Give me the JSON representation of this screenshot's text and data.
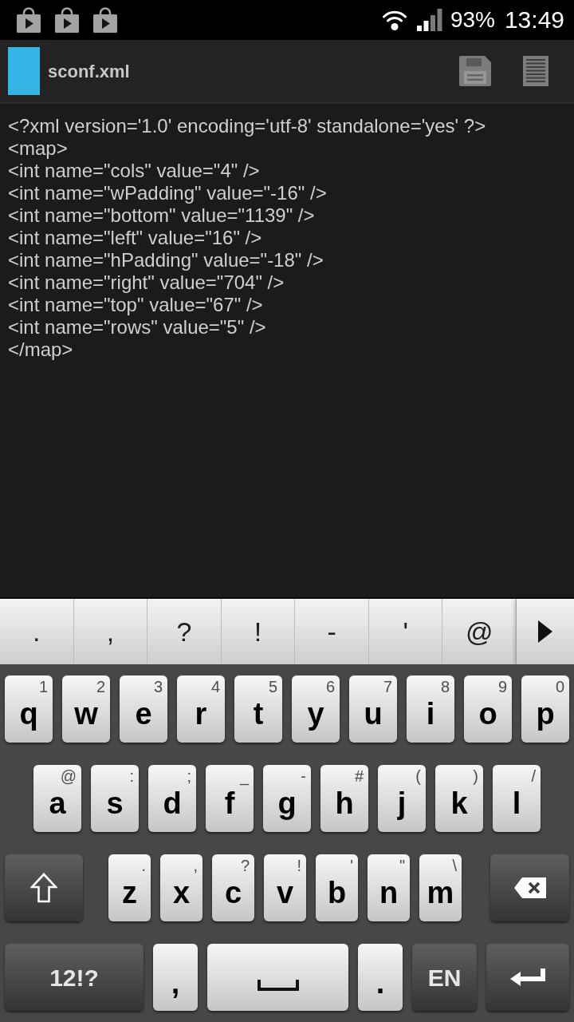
{
  "status_bar": {
    "battery": "93%",
    "time": "13:49"
  },
  "toolbar": {
    "title": "sconf.xml"
  },
  "editor": {
    "lines": [
      "<?xml version='1.0' encoding='utf-8' standalone='yes' ?>",
      "<map>",
      "<int name=\"cols\" value=\"4\" />",
      "<int name=\"wPadding\" value=\"-16\" />",
      "<int name=\"bottom\" value=\"1139\" />",
      "<int name=\"left\" value=\"16\" />",
      "<int name=\"hPadding\" value=\"-18\" />",
      "<int name=\"right\" value=\"704\" />",
      "<int name=\"top\" value=\"67\" />",
      "<int name=\"rows\" value=\"5\" />",
      "</map>"
    ]
  },
  "suggestions": [
    ".",
    ",",
    "?",
    "!",
    "-",
    "'",
    "@"
  ],
  "keyboard": {
    "rows": [
      {
        "keys": [
          {
            "kind": "letter",
            "label": "q",
            "hint": "1"
          },
          {
            "kind": "letter",
            "label": "w",
            "hint": "2"
          },
          {
            "kind": "letter",
            "label": "e",
            "hint": "3"
          },
          {
            "kind": "letter",
            "label": "r",
            "hint": "4"
          },
          {
            "kind": "letter",
            "label": "t",
            "hint": "5"
          },
          {
            "kind": "letter",
            "label": "y",
            "hint": "6"
          },
          {
            "kind": "letter",
            "label": "u",
            "hint": "7"
          },
          {
            "kind": "letter",
            "label": "i",
            "hint": "8"
          },
          {
            "kind": "letter",
            "label": "o",
            "hint": "9"
          },
          {
            "kind": "letter",
            "label": "p",
            "hint": "0"
          }
        ]
      },
      {
        "keys": [
          {
            "kind": "letter",
            "label": "a",
            "hint": "@"
          },
          {
            "kind": "letter",
            "label": "s",
            "hint": ":"
          },
          {
            "kind": "letter",
            "label": "d",
            "hint": ";"
          },
          {
            "kind": "letter",
            "label": "f",
            "hint": "_"
          },
          {
            "kind": "letter",
            "label": "g",
            "hint": "-"
          },
          {
            "kind": "letter",
            "label": "h",
            "hint": "#"
          },
          {
            "kind": "letter",
            "label": "j",
            "hint": "("
          },
          {
            "kind": "letter",
            "label": "k",
            "hint": ")"
          },
          {
            "kind": "letter",
            "label": "l",
            "hint": "/"
          }
        ]
      },
      {
        "keys": [
          {
            "kind": "shift"
          },
          {
            "kind": "letter",
            "label": "z",
            "hint": "."
          },
          {
            "kind": "letter",
            "label": "x",
            "hint": ","
          },
          {
            "kind": "letter",
            "label": "c",
            "hint": "?"
          },
          {
            "kind": "letter",
            "label": "v",
            "hint": "!"
          },
          {
            "kind": "letter",
            "label": "b",
            "hint": "'"
          },
          {
            "kind": "letter",
            "label": "n",
            "hint": "\""
          },
          {
            "kind": "letter",
            "label": "m",
            "hint": "\\"
          },
          {
            "kind": "backspace"
          }
        ]
      },
      {
        "keys": [
          {
            "kind": "mode",
            "label": "12!?"
          },
          {
            "kind": "punct",
            "label": ","
          },
          {
            "kind": "space"
          },
          {
            "kind": "punct",
            "label": "."
          },
          {
            "kind": "language",
            "label": "EN"
          },
          {
            "kind": "enter"
          }
        ]
      }
    ]
  }
}
